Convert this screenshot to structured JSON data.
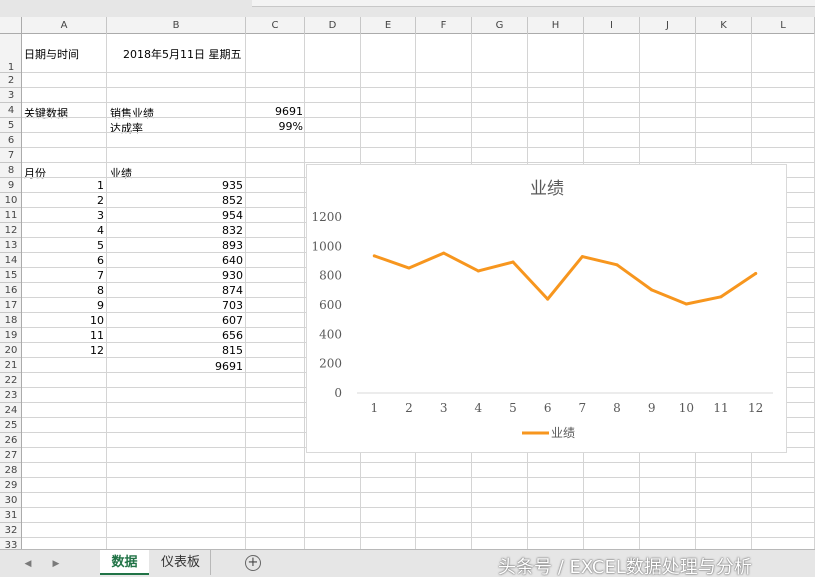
{
  "columns": [
    "A",
    "B",
    "C",
    "D",
    "E",
    "F",
    "G",
    "H",
    "I",
    "J",
    "K",
    "L"
  ],
  "rows": [
    "1",
    "2",
    "3",
    "4",
    "5",
    "6",
    "7",
    "8",
    "9",
    "10",
    "11",
    "12",
    "13",
    "14",
    "15",
    "16",
    "17",
    "18",
    "19",
    "20",
    "21",
    "22",
    "23",
    "24",
    "25",
    "26",
    "27",
    "28",
    "29",
    "30",
    "31",
    "32",
    "33"
  ],
  "cells": {
    "a1": "日期与时间",
    "b1": "2018年5月11日  星期五",
    "a4": "关键数据",
    "b4": "销售业绩",
    "c4": "9691",
    "b5": "达成率",
    "c5": "99%",
    "a8": "月份",
    "b8": "业绩",
    "b21": "9691"
  },
  "table": {
    "months": [
      "1",
      "2",
      "3",
      "4",
      "5",
      "6",
      "7",
      "8",
      "9",
      "10",
      "11",
      "12"
    ],
    "values": [
      "935",
      "852",
      "954",
      "832",
      "893",
      "640",
      "930",
      "874",
      "703",
      "607",
      "656",
      "815"
    ]
  },
  "chart_data": {
    "type": "line",
    "title": "业绩",
    "categories": [
      "1",
      "2",
      "3",
      "4",
      "5",
      "6",
      "7",
      "8",
      "9",
      "10",
      "11",
      "12"
    ],
    "series": [
      {
        "name": "业绩",
        "values": [
          935,
          852,
          954,
          832,
          893,
          640,
          930,
          874,
          703,
          607,
          656,
          815
        ],
        "color": "#F7961E"
      }
    ],
    "ylim": [
      0,
      1200
    ],
    "yticks": [
      "0",
      "200",
      "400",
      "600",
      "800",
      "1000",
      "1200"
    ],
    "grid": false,
    "legend": "bottom"
  },
  "sheet_tabs": {
    "active": "数据",
    "other": "仪表板",
    "add_symbol": "+",
    "prev_symbol": "◀",
    "next_symbol": "▶"
  },
  "watermark": "头条号 / EXCEL数据处理与分析",
  "colors": {
    "accent": "#217346",
    "series": "#F7961E"
  }
}
